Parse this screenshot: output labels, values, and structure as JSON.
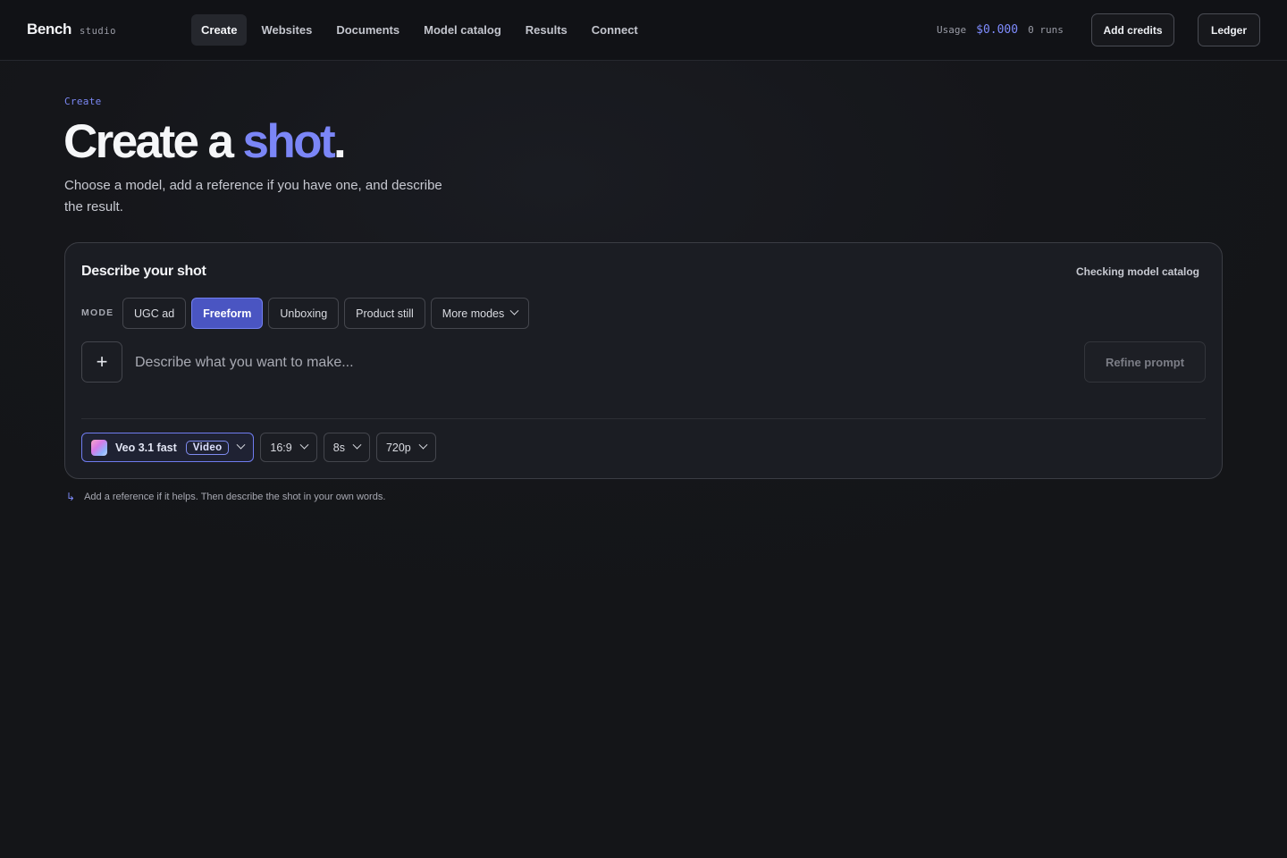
{
  "brand": {
    "name": "Bench",
    "sub": "studio"
  },
  "nav": [
    {
      "label": "Create",
      "active": true
    },
    {
      "label": "Websites"
    },
    {
      "label": "Documents"
    },
    {
      "label": "Model catalog"
    },
    {
      "label": "Results"
    },
    {
      "label": "Connect"
    }
  ],
  "usage": {
    "label": "Usage",
    "amount": "$0.000",
    "runs": "0 runs"
  },
  "header_buttons": {
    "add_credits": "Add credits",
    "ledger": "Ledger"
  },
  "hero": {
    "eyebrow": "Create",
    "title_prefix": "Create a ",
    "title_accent": "shot",
    "title_suffix": ".",
    "subtitle": "Choose a model, add a reference if you have one, and describe the result."
  },
  "card": {
    "title": "Describe your shot",
    "status": "Checking model catalog",
    "mode_label": "MODE",
    "modes": [
      {
        "label": "UGC ad"
      },
      {
        "label": "Freeform",
        "active": true
      },
      {
        "label": "Unboxing"
      },
      {
        "label": "Product still"
      }
    ],
    "more_modes": "More modes",
    "add_icon": "+",
    "prompt_placeholder": "Describe what you want to make...",
    "refine_label": "Refine prompt",
    "model": {
      "name": "Veo 3.1 fast",
      "badge": "Video"
    },
    "aspect": "16:9",
    "duration": "8s",
    "resolution": "720p"
  },
  "hint": {
    "icon": "↳",
    "text": "Add a reference if it helps. Then describe the shot in your own words."
  },
  "colors": {
    "accent": "#7b86f7",
    "background": "#141518",
    "card": "#1b1d23"
  }
}
